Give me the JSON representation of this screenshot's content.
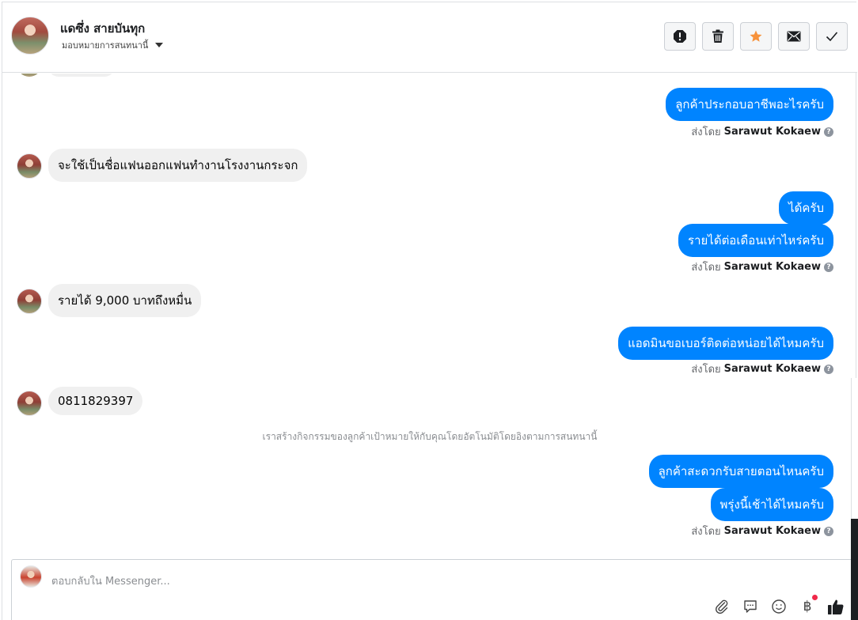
{
  "header": {
    "contact_name": "แดซึ่ง สายบันทุก",
    "assign_label": "มอบหมายการสนทนานี้",
    "actions": [
      {
        "name": "report-button",
        "icon": "exclamation-circle-icon"
      },
      {
        "name": "delete-button",
        "icon": "trash-icon"
      },
      {
        "name": "star-button",
        "icon": "star-icon"
      },
      {
        "name": "mark-unread-button",
        "icon": "envelope-icon"
      },
      {
        "name": "mark-done-button",
        "icon": "check-icon"
      }
    ]
  },
  "messages": {
    "out_1": "ลูกค้าประกอบอาชีพอะไรครับ",
    "sent_by_prefix": "ส่งโดย",
    "sender_name": "Sarawut Kokaew",
    "in_1": "จะใช้เป็นชื่อแฟนออกแฟนทำงานโรงงานกระจก",
    "out_2": "ได้ครับ",
    "out_3": "รายได้ต่อเดือนเท่าไหร่ครับ",
    "in_2": "รายได้ 9,000 บาทถึงหมื่น",
    "out_4": "แอดมินขอเบอร์ติดต่อหน่อยได้ไหมครับ",
    "in_3": "0811829397",
    "system_note": "เราสร้างกิจกรรมของลูกค้าเป้าหมายให้กับคุณโดยอัตโนมัติโดยอิงตามการสนทนานี้",
    "out_5": "ลูกค้าสะดวกรับสายตอนไหนครับ",
    "out_6": "พรุ่งนี้เช้าได้ไหมครับ"
  },
  "composer": {
    "placeholder": "ตอบกลับใน Messenger..."
  },
  "colors": {
    "outgoing_bubble": "#0084ff",
    "incoming_bubble": "#f0f0f0",
    "star": "#f7923b",
    "notification_dot": "#f02849"
  }
}
